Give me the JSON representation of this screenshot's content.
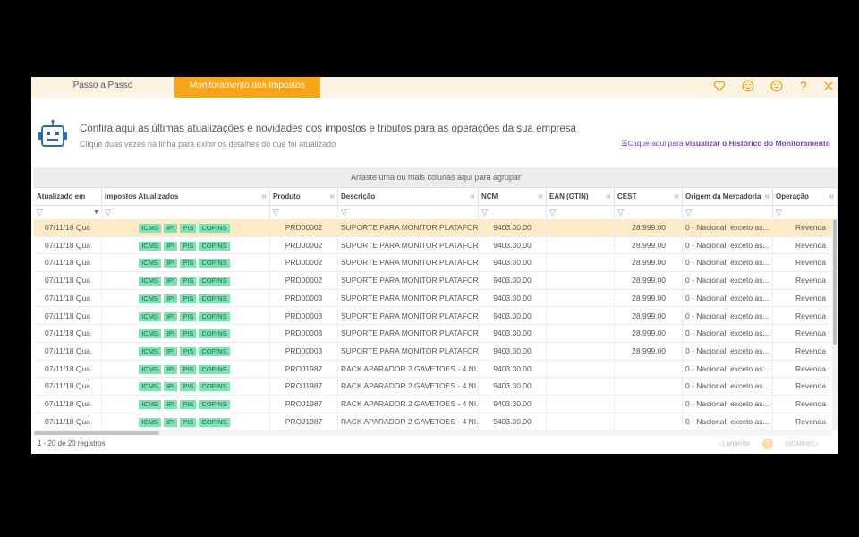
{
  "tabs": [
    {
      "label": "Passo a Passo"
    },
    {
      "label": "Monitoramento dos Impostos"
    }
  ],
  "top_icons": [
    "heart-icon",
    "smile-icon",
    "smile-alt-icon",
    "help-icon",
    "close-icon"
  ],
  "header": {
    "title": "Confira aqui as últimas atualizações e novidades dos impostos e tributos para as operações da sua empresa",
    "subtitle": "Clique duas vezes na linha para exibir os detalhes do que foi atualizado",
    "history_prefix": "Clique aqui para ",
    "history_link": "visualizar o Histórico do Monitoramento"
  },
  "grid": {
    "group_hint": "Arraste uma ou mais colunas aqui para agrupar",
    "columns": [
      "Atualizado em",
      "Impostos Atualizados",
      "Produto",
      "Descrição",
      "NCM",
      "EAN (GTIN)",
      "CEST",
      "Origem da Mercadoria",
      "Operação"
    ],
    "filter_icon": "▽",
    "collapse_icon": "«",
    "rows": [
      {
        "date": "07/11/18 Qua",
        "taxes": [
          "ICMS",
          "IPI",
          "PIS",
          "COFINS"
        ],
        "produto": "PRD00002",
        "descricao": "SUPORTE PARA MONITOR PLATAFOR...",
        "ncm": "9403.30.00",
        "ean": "",
        "cest": "28.999.00",
        "origem": "0 - Nacional, exceto as...",
        "operacao": "Revenda"
      },
      {
        "date": "07/11/18 Qua",
        "taxes": [
          "ICMS",
          "IPI",
          "PIS",
          "COFINS"
        ],
        "produto": "PRD00002",
        "descricao": "SUPORTE PARA MONITOR PLATAFOR...",
        "ncm": "9403.30.00",
        "ean": "",
        "cest": "28.999.00",
        "origem": "0 - Nacional, exceto as...",
        "operacao": "Revenda"
      },
      {
        "date": "07/11/18 Qua",
        "taxes": [
          "ICMS",
          "IPI",
          "PIS",
          "COFINS"
        ],
        "produto": "PRD00002",
        "descricao": "SUPORTE PARA MONITOR PLATAFOR...",
        "ncm": "9403.30.00",
        "ean": "",
        "cest": "28.999.00",
        "origem": "0 - Nacional, exceto as...",
        "operacao": "Revenda"
      },
      {
        "date": "07/11/18 Qua",
        "taxes": [
          "ICMS",
          "IPI",
          "PIS",
          "COFINS"
        ],
        "produto": "PRD00002",
        "descricao": "SUPORTE PARA MONITOR PLATAFOR...",
        "ncm": "9403.30.00",
        "ean": "",
        "cest": "28.999.00",
        "origem": "0 - Nacional, exceto as...",
        "operacao": "Revenda"
      },
      {
        "date": "07/11/18 Qua",
        "taxes": [
          "ICMS",
          "IPI",
          "PIS",
          "COFINS"
        ],
        "produto": "PRD00003",
        "descricao": "SUPORTE PARA MONITOR PLATAFOR...",
        "ncm": "9403.30.00",
        "ean": "",
        "cest": "28.999.00",
        "origem": "0 - Nacional, exceto as...",
        "operacao": "Revenda"
      },
      {
        "date": "07/11/18 Qua",
        "taxes": [
          "ICMS",
          "IPI",
          "PIS",
          "COFINS"
        ],
        "produto": "PRD00003",
        "descricao": "SUPORTE PARA MONITOR PLATAFOR...",
        "ncm": "9403.30.00",
        "ean": "",
        "cest": "28.999.00",
        "origem": "0 - Nacional, exceto as...",
        "operacao": "Revenda"
      },
      {
        "date": "07/11/18 Qua",
        "taxes": [
          "ICMS",
          "IPI",
          "PIS",
          "COFINS"
        ],
        "produto": "PRD00003",
        "descricao": "SUPORTE PARA MONITOR PLATAFOR...",
        "ncm": "9403.30.00",
        "ean": "",
        "cest": "28.999.00",
        "origem": "0 - Nacional, exceto as...",
        "operacao": "Revenda"
      },
      {
        "date": "07/11/18 Qua",
        "taxes": [
          "ICMS",
          "IPI",
          "PIS",
          "COFINS"
        ],
        "produto": "PRD00003",
        "descricao": "SUPORTE PARA MONITOR PLATAFOR...",
        "ncm": "9403.30.00",
        "ean": "",
        "cest": "28.999.00",
        "origem": "0 - Nacional, exceto as...",
        "operacao": "Revenda"
      },
      {
        "date": "07/11/18 Qua",
        "taxes": [
          "ICMS",
          "IPI",
          "PIS",
          "COFINS"
        ],
        "produto": "PROJ1987",
        "descricao": "RACK APARADOR 2 GAVETOES - 4 NI...",
        "ncm": "9403.30.00",
        "ean": "",
        "cest": "",
        "origem": "0 - Nacional, exceto as...",
        "operacao": "Revenda"
      },
      {
        "date": "07/11/18 Qua",
        "taxes": [
          "ICMS",
          "IPI",
          "PIS",
          "COFINS"
        ],
        "produto": "PROJ1987",
        "descricao": "RACK APARADOR 2 GAVETOES - 4 NI...",
        "ncm": "9403.30.00",
        "ean": "",
        "cest": "",
        "origem": "0 - Nacional, exceto as...",
        "operacao": "Revenda"
      },
      {
        "date": "07/11/18 Qua",
        "taxes": [
          "ICMS",
          "IPI",
          "PIS",
          "COFINS"
        ],
        "produto": "PROJ1987",
        "descricao": "RACK APARADOR 2 GAVETOES - 4 NI...",
        "ncm": "9403.30.00",
        "ean": "",
        "cest": "",
        "origem": "0 - Nacional, exceto as...",
        "operacao": "Revenda"
      },
      {
        "date": "07/11/18 Qua",
        "taxes": [
          "ICMS",
          "IPI",
          "PIS",
          "COFINS"
        ],
        "produto": "PROJ1987",
        "descricao": "RACK APARADOR 2 GAVETOES - 4 NI...",
        "ncm": "9403.30.00",
        "ean": "",
        "cest": "",
        "origem": "0 - Nacional, exceto as...",
        "operacao": "Revenda"
      }
    ],
    "selected_row": 0
  },
  "footer": {
    "count": "1 - 20 de 20 registros",
    "prev": "◁ anterior",
    "page": "1",
    "next": "próximo ▷"
  },
  "colors": {
    "accent": "#f9a51a",
    "tag_bg": "#7ee3b3",
    "link": "#7b3fd1",
    "robot": "#2b6cb0"
  }
}
